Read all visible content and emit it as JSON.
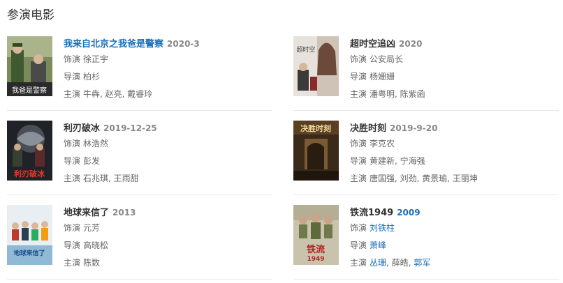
{
  "section_title": "参演电影",
  "movies": [
    {
      "title": "我来自北京之我爸是警察",
      "year": "2020-3",
      "role_label": "饰演",
      "role": "徐正宇",
      "director_label": "导演",
      "director": "柏杉",
      "cast_label": "主演",
      "cast": "牛犇, 赵亮, 戴睿玲",
      "poster_text": "我爸是警察",
      "colors": {
        "title": "#1a6eb8"
      }
    },
    {
      "title": "超时空追凶",
      "year": "2020",
      "role_label": "饰演",
      "role": "公安局长",
      "director_label": "导演",
      "director": "杨姗姗",
      "cast_label": "主演",
      "cast": "潘粤明, 陈紫函",
      "poster_text": "超时空",
      "colors": {
        "title": "#333333"
      }
    },
    {
      "title": "利刃破冰",
      "year": "2019-12-25",
      "role_label": "饰演",
      "role": "林浩然",
      "director_label": "导演",
      "director": "彭发",
      "cast_label": "主演",
      "cast": "石兆琪, 王雨甜",
      "poster_text": "利刃破冰",
      "colors": {
        "title": "#333333"
      }
    },
    {
      "title": "决胜时刻",
      "year": "2019-9-20",
      "role_label": "饰演",
      "role": "李克农",
      "director_label": "导演",
      "director": "黄建新, 宁海强",
      "cast_label": "主演",
      "cast": "唐国强, 刘劲, 黄景瑜, 王丽坤",
      "poster_text": "决胜时刻",
      "colors": {
        "title": "#333333"
      }
    },
    {
      "title": "地球来信了",
      "year": "2013",
      "role_label": "饰演",
      "role": "元芳",
      "director_label": "导演",
      "director": "高晓松",
      "cast_label": "主演",
      "cast": "陈数",
      "poster_text": "地球来信了",
      "colors": {
        "title": "#333333"
      }
    },
    {
      "title": "铁流1949",
      "year": "2009",
      "role_label": "饰演",
      "role": "刘铁柱",
      "director_label": "导演",
      "director": "萧峰",
      "cast_label": "主演",
      "cast_1": "丛珊",
      "cast_2": "薛皓",
      "cast_3": "郭军",
      "poster_text": "铁流",
      "poster_year": "1949",
      "colors": {
        "title": "#333333",
        "link": "#1a6eb8"
      }
    }
  ]
}
